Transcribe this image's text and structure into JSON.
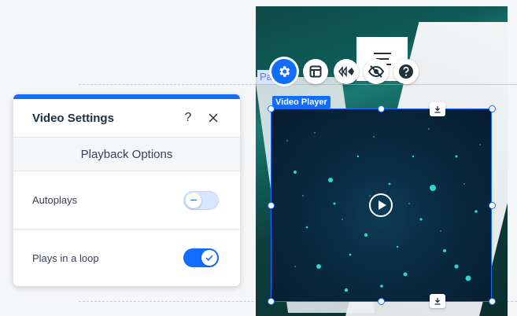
{
  "colors": {
    "accent": "#116dff",
    "panel_bg": "#ffffff",
    "section_bg": "#f4f6f8"
  },
  "stage": {
    "page_tag": "Pa",
    "menu_icon": "hamburger-icon",
    "toolbar": [
      {
        "name": "settings-button",
        "icon": "gear-icon"
      },
      {
        "name": "layout-button",
        "icon": "layout-icon"
      },
      {
        "name": "animation-button",
        "icon": "animation-icon"
      },
      {
        "name": "hide-button",
        "icon": "eye-slash-icon"
      },
      {
        "name": "help-button",
        "icon": "question-icon"
      }
    ],
    "video": {
      "label": "Video Player",
      "play_icon": "play-icon",
      "download_icon": "download-icon"
    }
  },
  "panel": {
    "title": "Video Settings",
    "help_icon": "?",
    "close_icon": "close-icon",
    "section": "Playback Options",
    "options": [
      {
        "label": "Autoplays",
        "enabled": false
      },
      {
        "label": "Plays in a loop",
        "enabled": true
      }
    ]
  }
}
